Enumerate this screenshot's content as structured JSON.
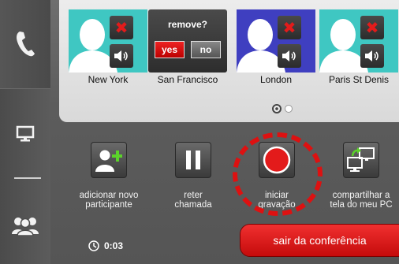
{
  "participants": [
    {
      "name": "New York",
      "avatar_color": "#3fc7c2"
    },
    {
      "name": "San Francisco",
      "avatar_color": "#3a3a3a"
    },
    {
      "name": "London",
      "avatar_color": "#3f3fc0"
    },
    {
      "name": "Paris St Denis",
      "avatar_color": "#3fc7c2"
    }
  ],
  "remove_dialog": {
    "question": "remove?",
    "yes": "yes",
    "no": "no"
  },
  "actions": {
    "add": "adicionar novo\nparticipante",
    "hold": "reter\nchamada",
    "record": "iniciar\ngravação",
    "share": "compartilhar a\ntela do meu PC"
  },
  "timer": "0:03",
  "leave_label": "sair da conferência",
  "colors": {
    "accent_red": "#e31b1b",
    "recording_ring": "#d11111"
  }
}
